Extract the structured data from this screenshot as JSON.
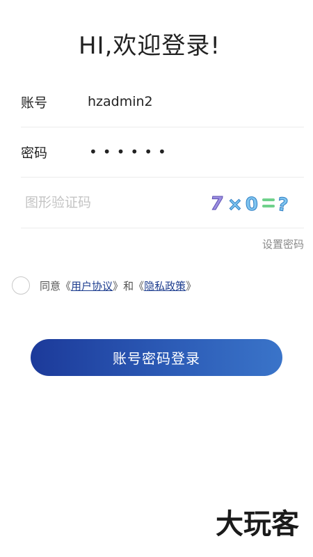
{
  "header": {
    "title": "HI,欢迎登录!"
  },
  "form": {
    "account_label": "账号",
    "account_value": "hzadmin2",
    "password_label": "密码",
    "password_value": "••••••",
    "captcha_placeholder": "图形验证码",
    "captcha_image": "7×0=?",
    "set_password_label": "设置密码"
  },
  "agreement": {
    "prefix": "同意",
    "open1": "《",
    "user_agreement": "用户协议",
    "close1": "》",
    "and": "和",
    "open2": "《",
    "privacy_policy": "隐私政策",
    "close2": "》"
  },
  "actions": {
    "login_label": "账号密码登录"
  },
  "watermark": {
    "text": "大玩客"
  }
}
